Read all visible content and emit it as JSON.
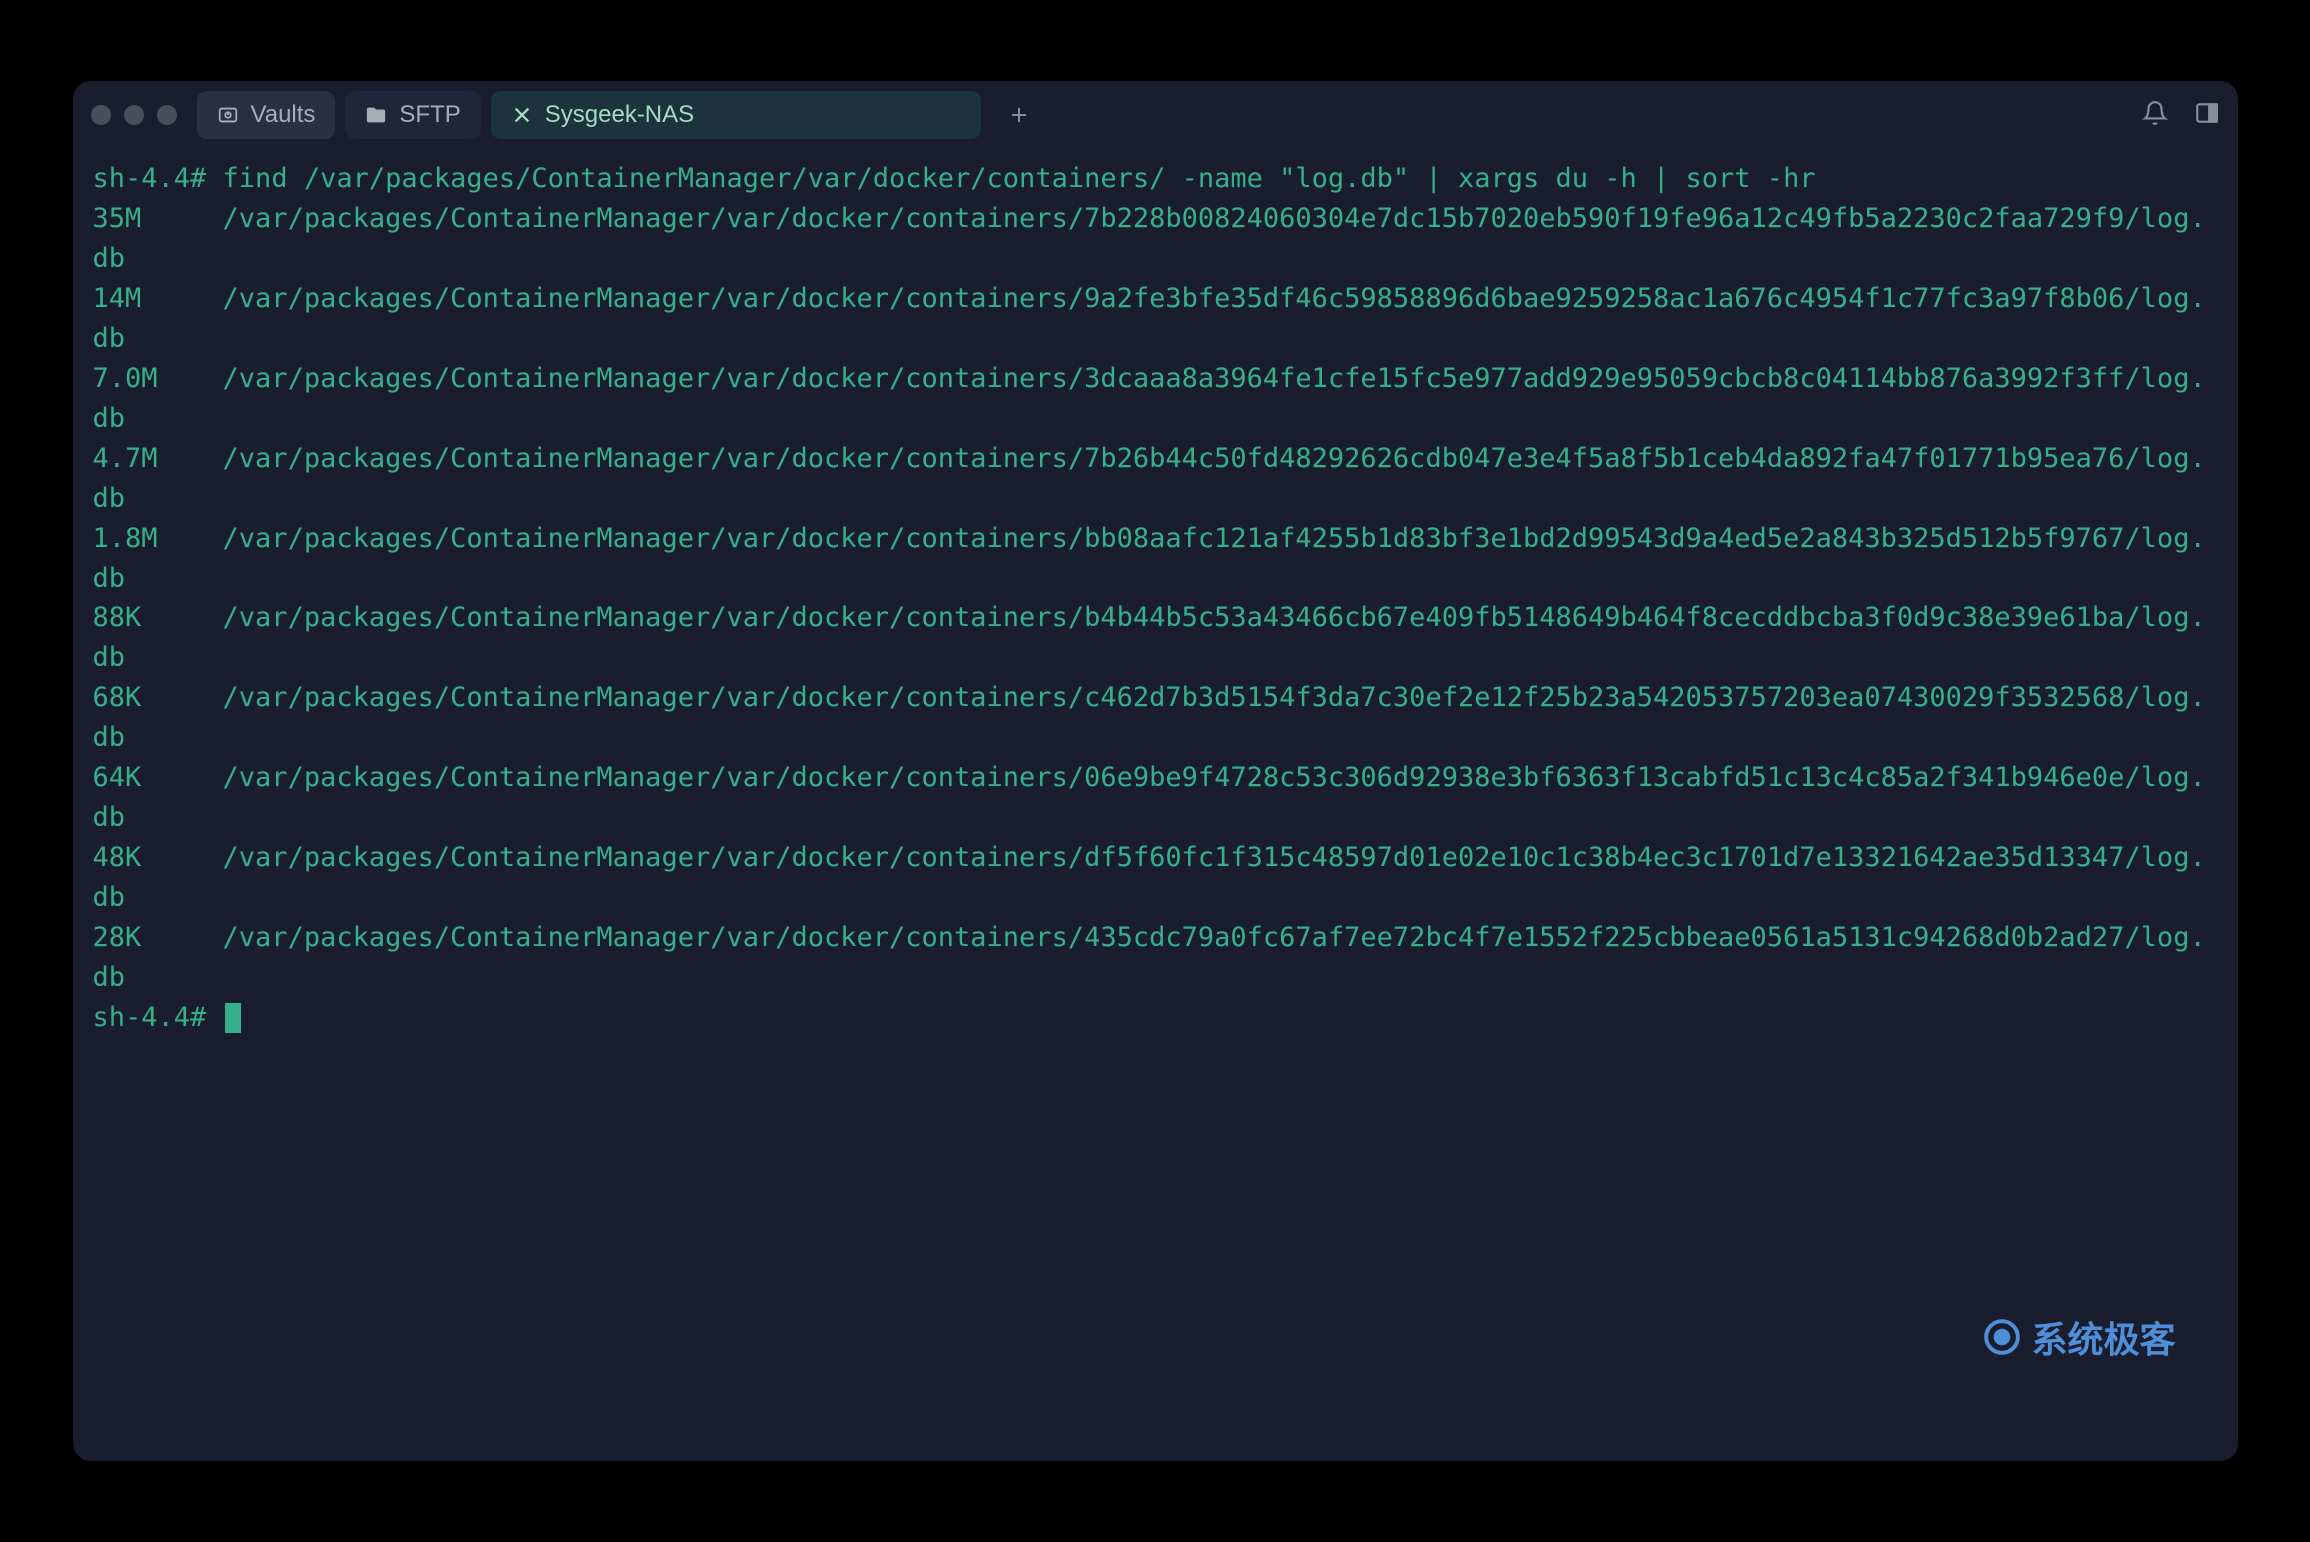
{
  "tabs": {
    "vaults": "Vaults",
    "sftp": "SFTP",
    "active": "Sysgeek-NAS"
  },
  "terminal": {
    "prompt": "sh-4.4# ",
    "command": "find /var/packages/ContainerManager/var/docker/containers/ -name \"log.db\" | xargs du -h | sort -hr",
    "output_lines": [
      "35M     /var/packages/ContainerManager/var/docker/containers/7b228b00824060304e7dc15b7020eb590f19fe96a12c49fb5a2230c2faa729f9/log.db",
      "14M     /var/packages/ContainerManager/var/docker/containers/9a2fe3bfe35df46c59858896d6bae9259258ac1a676c4954f1c77fc3a97f8b06/log.db",
      "7.0M    /var/packages/ContainerManager/var/docker/containers/3dcaaa8a3964fe1cfe15fc5e977add929e95059cbcb8c04114bb876a3992f3ff/log.db",
      "4.7M    /var/packages/ContainerManager/var/docker/containers/7b26b44c50fd48292626cdb047e3e4f5a8f5b1ceb4da892fa47f01771b95ea76/log.db",
      "1.8M    /var/packages/ContainerManager/var/docker/containers/bb08aafc121af4255b1d83bf3e1bd2d99543d9a4ed5e2a843b325d512b5f9767/log.db",
      "88K     /var/packages/ContainerManager/var/docker/containers/b4b44b5c53a43466cb67e409fb5148649b464f8cecddbcba3f0d9c38e39e61ba/log.db",
      "68K     /var/packages/ContainerManager/var/docker/containers/c462d7b3d5154f3da7c30ef2e12f25b23a542053757203ea07430029f3532568/log.db",
      "64K     /var/packages/ContainerManager/var/docker/containers/06e9be9f4728c53c306d92938e3bf6363f13cabfd51c13c4c85a2f341b946e0e/log.db",
      "48K     /var/packages/ContainerManager/var/docker/containers/df5f60fc1f315c48597d01e02e10c1c38b4ec3c1701d7e13321642ae35d13347/log.db",
      "28K     /var/packages/ContainerManager/var/docker/containers/435cdc79a0fc67af7ee72bc4f7e1552f225cbbeae0561a5131c94268d0b2ad27/log.db"
    ],
    "final_prompt": "sh-4.4# "
  },
  "watermark": {
    "text": "系统极客"
  }
}
